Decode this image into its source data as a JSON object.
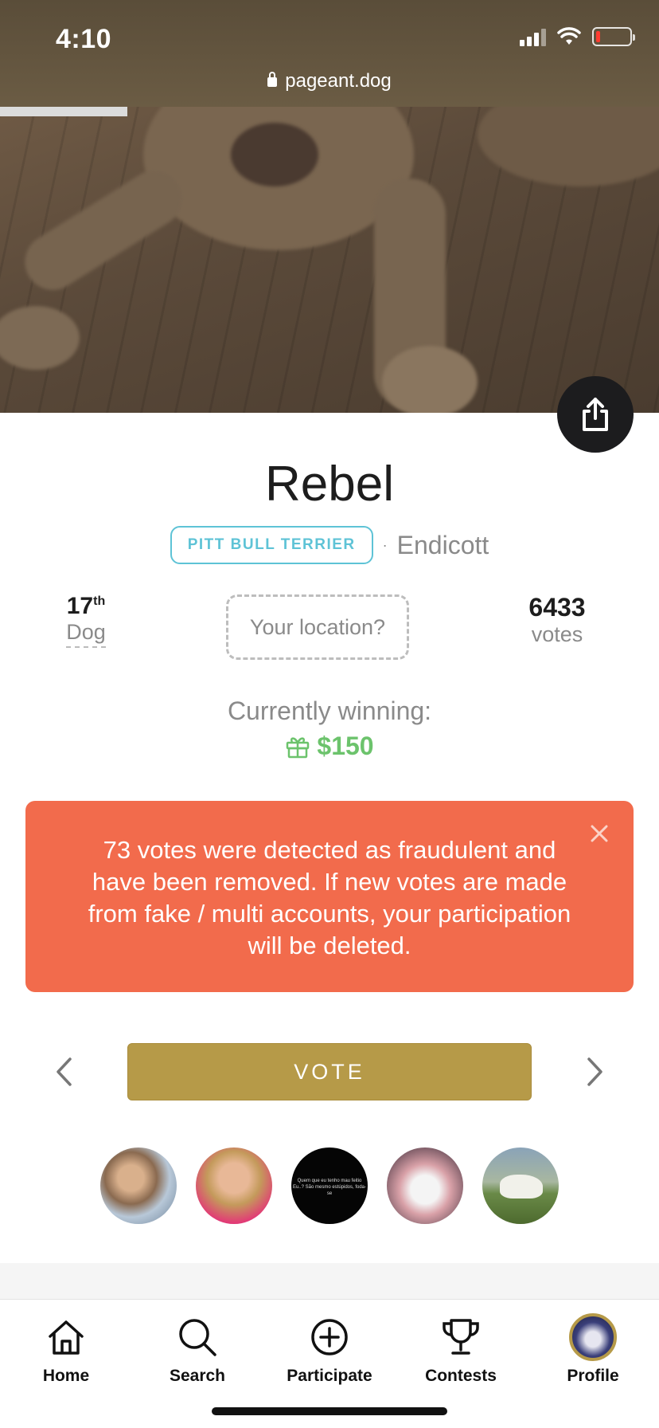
{
  "status_bar": {
    "time": "4:10",
    "battery_level": 0.12,
    "battery_color": "#ff3b30",
    "icons": [
      "cellular-signal-icon",
      "wifi-icon",
      "battery-icon"
    ]
  },
  "browser": {
    "url": "pageant.dog",
    "icon": "lock-icon"
  },
  "dog": {
    "name": "Rebel",
    "breed": "PITT BULL TERRIER",
    "separator": "·",
    "city": "Endicott"
  },
  "stats": {
    "rank": "17",
    "rank_suffix": "th",
    "rank_label": "Dog",
    "location_placeholder": "Your location?",
    "votes": "6433",
    "votes_label": "votes"
  },
  "prize": {
    "label": "Currently winning:",
    "amount": "$150",
    "icon": "gift-icon",
    "color": "#6cc36c"
  },
  "alert": {
    "message": "73 votes were detected as fraudulent and have been removed. If new votes are made from fake / multi accounts, your participation will be deleted.",
    "background": "#f26b4c"
  },
  "vote": {
    "label": "VOTE",
    "color": "#b69a48",
    "prev_icon": "chevron-left-icon",
    "next_icon": "chevron-right-icon"
  },
  "voters": {
    "avatar3_text": "Quem que eu tenho mau feitio Eu..? São mesmo estúpidos, foda-se"
  },
  "tabbar": {
    "items": [
      {
        "label": "Home",
        "icon": "home-icon"
      },
      {
        "label": "Search",
        "icon": "search-icon"
      },
      {
        "label": "Participate",
        "icon": "plus-circle-icon"
      },
      {
        "label": "Contests",
        "icon": "trophy-icon"
      },
      {
        "label": "Profile",
        "icon": "profile-avatar"
      }
    ]
  },
  "accent_gold": "#b69a48",
  "accent_cyan": "#5ec3d6"
}
